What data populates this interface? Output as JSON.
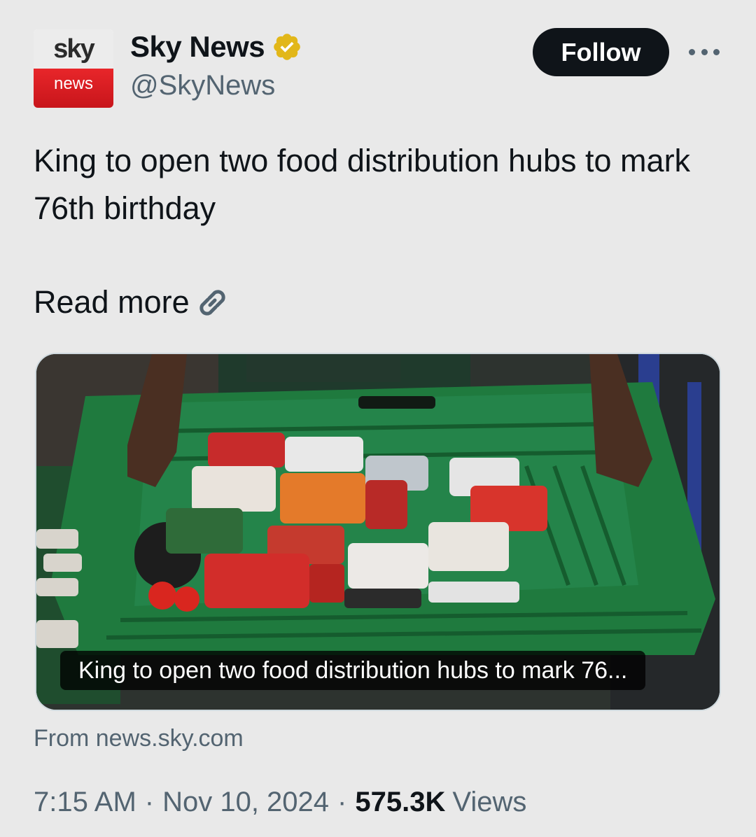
{
  "account": {
    "avatar_top": "sky",
    "avatar_bottom": "news",
    "display_name": "Sky News",
    "handle": "@SkyNews",
    "verified_color": "#e2b719"
  },
  "actions": {
    "follow_label": "Follow",
    "more_icon": "more-horizontal-icon"
  },
  "post": {
    "text": "King to open two food distribution hubs to mark 76th birthday",
    "read_more": "Read more",
    "link_icon": "link-icon"
  },
  "card": {
    "caption": "King to open two food distribution hubs to mark 76...",
    "source": "From news.sky.com"
  },
  "meta": {
    "time": "7:15 AM",
    "separator": "·",
    "date": "Nov 10, 2024",
    "views_count": "575.3K",
    "views_label": "Views"
  }
}
